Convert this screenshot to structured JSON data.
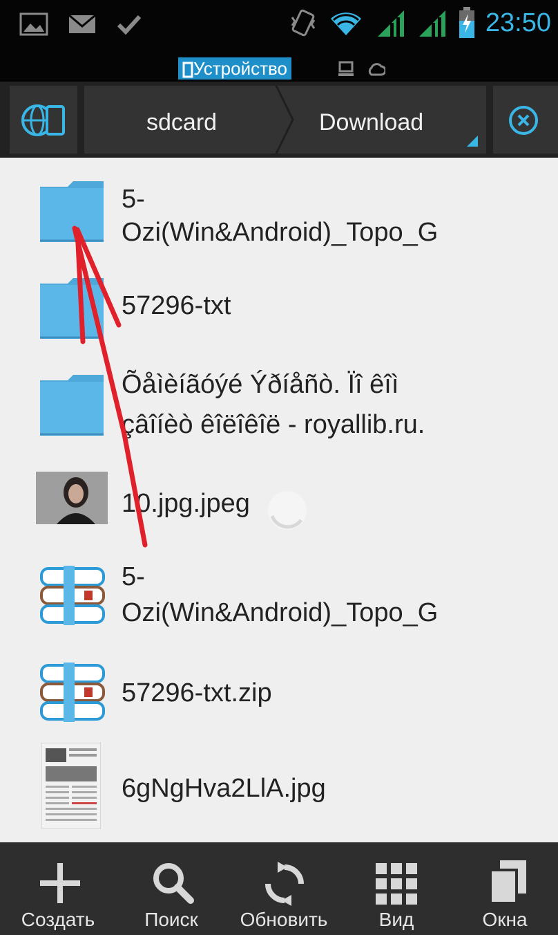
{
  "status_bar": {
    "time": "23:50",
    "icons": [
      "image-icon",
      "mail-icon",
      "check-icon",
      "vibrate-icon",
      "wifi-icon",
      "signal-1-icon",
      "signal-2-icon",
      "battery-charging-icon"
    ]
  },
  "device_bar": {
    "selected_label": "Устройство",
    "icons": [
      "device-icon",
      "computer-icon",
      "cloud-icon"
    ]
  },
  "breadcrumb": {
    "items": [
      "sdcard",
      "Download"
    ]
  },
  "files": [
    {
      "name_line1": "5-",
      "name_line2": "Ozi(Win&Android)_Topo_G",
      "icon": "folder-icon"
    },
    {
      "name_line1": "57296-txt",
      "icon": "folder-icon"
    },
    {
      "name_line1": "Õåìèíãóýé Ýðíåñò. Ïî êîì",
      "name_line2": "çâîíèò êîëîêîë - royallib.ru.",
      "icon": "folder-icon"
    },
    {
      "name_line1": "10.jpg.jpeg",
      "icon": "image-thumbnail-icon"
    },
    {
      "name_line1": "5-",
      "name_line2": "Ozi(Win&Android)_Topo_G",
      "icon": "archive-icon"
    },
    {
      "name_line1": "57296-txt.zip",
      "icon": "archive-icon"
    },
    {
      "name_line1": "6gNgHva2LlA.jpg",
      "icon": "image-thumbnail-icon"
    }
  ],
  "bottom_bar": {
    "create": "Создать",
    "search": "Поиск",
    "refresh": "Обновить",
    "view": "Вид",
    "windows": "Окна"
  },
  "colors": {
    "accent": "#3ab6e6",
    "folder": "#5bb7e8",
    "annotation_arrow": "#e0202a"
  }
}
